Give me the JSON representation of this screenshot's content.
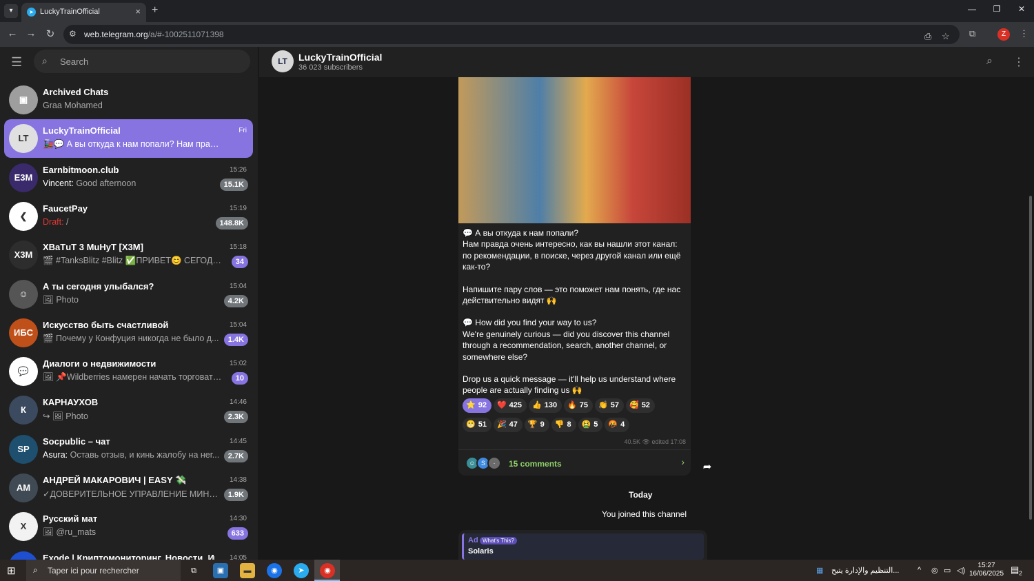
{
  "browser": {
    "tab_title": "LuckyTrainOfficial",
    "url_host": "web.telegram.org",
    "url_path": "/a/#-1002511071398",
    "profile_initial": "Z"
  },
  "sidebar": {
    "search_placeholder": "Search",
    "chats": [
      {
        "name": "Archived Chats",
        "time": "",
        "message": "Graa Mohamed",
        "sender": "",
        "badge": "",
        "avatar_color": "#9e9e9e",
        "avatar_text": "▣"
      },
      {
        "name": "LuckyTrainOfficial",
        "time": "Fri",
        "message": "🚂💬 А вы откуда к нам попали? Нам правда оч...",
        "sender": "",
        "badge": "",
        "avatar_color": "#e0e0e0",
        "avatar_text": "LT"
      },
      {
        "name": "Earnbitmoon.club",
        "time": "15:26",
        "message": "Good afternoon",
        "sender": "Vincent: ",
        "badge": "15.1K",
        "avatar_color": "#3a2a6b",
        "avatar_text": "E3M"
      },
      {
        "name": "FaucetPay",
        "time": "15:19",
        "message": "/",
        "sender": "Draft: ",
        "badge": "148.8K",
        "avatar_color": "#ffffff",
        "avatar_text": "❮"
      },
      {
        "name": "ХВаТuТ 3 МuНуТ [X3M]",
        "time": "15:18",
        "message": "🎬 #TanksBlitz #Blitz ✅ПРИВЕТ😊 СЕГОДНЯ ...",
        "sender": "",
        "badge": "34",
        "avatar_color": "#2d2d2d",
        "avatar_text": "X3M"
      },
      {
        "name": "А ты сегодня улыбался?",
        "time": "15:04",
        "message": "🖼 Photo",
        "sender": "",
        "badge": "4.2K",
        "avatar_color": "#555555",
        "avatar_text": "☺"
      },
      {
        "name": "Искусство быть счастливой",
        "time": "15:04",
        "message": "🎬 Почему у Конфуция никогда не было д...",
        "sender": "",
        "badge": "1.4K",
        "avatar_color": "#c0501a",
        "avatar_text": "ИБС"
      },
      {
        "name": "Диалоги о недвижимости",
        "time": "15:02",
        "message": "🖼 📌Wildberries намерен начать торговать ...",
        "sender": "",
        "badge": "10",
        "avatar_color": "#ffffff",
        "avatar_text": "💬"
      },
      {
        "name": "КАРНАУХОВ",
        "time": "14:46",
        "message": "↪ 🖼 Photo",
        "sender": "",
        "badge": "2.3K",
        "avatar_color": "#3b4a5e",
        "avatar_text": "К"
      },
      {
        "name": "Socpublic – чат",
        "time": "14:45",
        "message": "Оставь отзыв, и кинь жалобу на нег...",
        "sender": "Asura: ",
        "badge": "2.7K",
        "avatar_color": "#1e4f6e",
        "avatar_text": "SP"
      },
      {
        "name": "АНДРЕЙ МАКАРОВИЧ | EASY 💸",
        "time": "14:38",
        "message": "✓ДОВЕРИТЕЛЬНОЕ УПРАВЛЕНИЕ МИНИ...",
        "sender": "",
        "badge": "1.9K",
        "avatar_color": "#404a55",
        "avatar_text": "АМ"
      },
      {
        "name": "Русский мат",
        "time": "14:30",
        "message": "🖼 @ru_mats",
        "sender": "",
        "badge": "633",
        "avatar_color": "#f2f2f2",
        "avatar_text": "Х"
      },
      {
        "name": "Ехоdе | Криптомониторинг. Новости. Инса...",
        "time": "14:05",
        "message": "",
        "sender": "",
        "badge": "",
        "avatar_color": "#1f4fd1",
        "avatar_text": "E"
      }
    ]
  },
  "channel": {
    "title": "LuckyTrainOfficial",
    "subscribers": "36 023 subscribers"
  },
  "post": {
    "paragraphs": [
      "💬 А вы откуда к нам попали?\nНам правда очень интересно, как вы нашли этот канал: по рекомендации, в поиске, через другой канал или ещё как-то?",
      "Напишите пару слов — это поможет нам понять, где нас действительно видят 🙌",
      "💬 How did you find your way to us?\nWe're genuinely curious — did you discover this channel through a recommendation, search, another channel, or somewhere else?",
      "Drop us a quick message — it'll help us understand where people are actually finding us 🙌"
    ],
    "reactions": [
      {
        "emoji": "⭐",
        "count": "92",
        "mine": true
      },
      {
        "emoji": "❤️",
        "count": "425",
        "mine": false
      },
      {
        "emoji": "👍",
        "count": "130",
        "mine": false
      },
      {
        "emoji": "🔥",
        "count": "75",
        "mine": false
      },
      {
        "emoji": "👏",
        "count": "57",
        "mine": false
      },
      {
        "emoji": "🥰",
        "count": "52",
        "mine": false
      },
      {
        "emoji": "😁",
        "count": "51",
        "mine": false
      },
      {
        "emoji": "🎉",
        "count": "47",
        "mine": false
      },
      {
        "emoji": "🏆",
        "count": "9",
        "mine": false
      },
      {
        "emoji": "👎",
        "count": "8",
        "mine": false
      },
      {
        "emoji": "🤮",
        "count": "5",
        "mine": false
      },
      {
        "emoji": "🤬",
        "count": "4",
        "mine": false
      }
    ],
    "views": "40.5K",
    "edited": "edited 17:08",
    "comments_label": "15 comments"
  },
  "service": {
    "date": "Today",
    "joined": "You joined this channel"
  },
  "ad": {
    "label": "Ad",
    "whats_this": "What's This?",
    "title": "Solaris"
  },
  "taskbar": {
    "search_placeholder": "Taper ici pour rechercher",
    "tray_text": "التنظيم والإدارة يتيح...",
    "time": "15:27",
    "date": "16/06/2025",
    "notif_count": "2"
  }
}
